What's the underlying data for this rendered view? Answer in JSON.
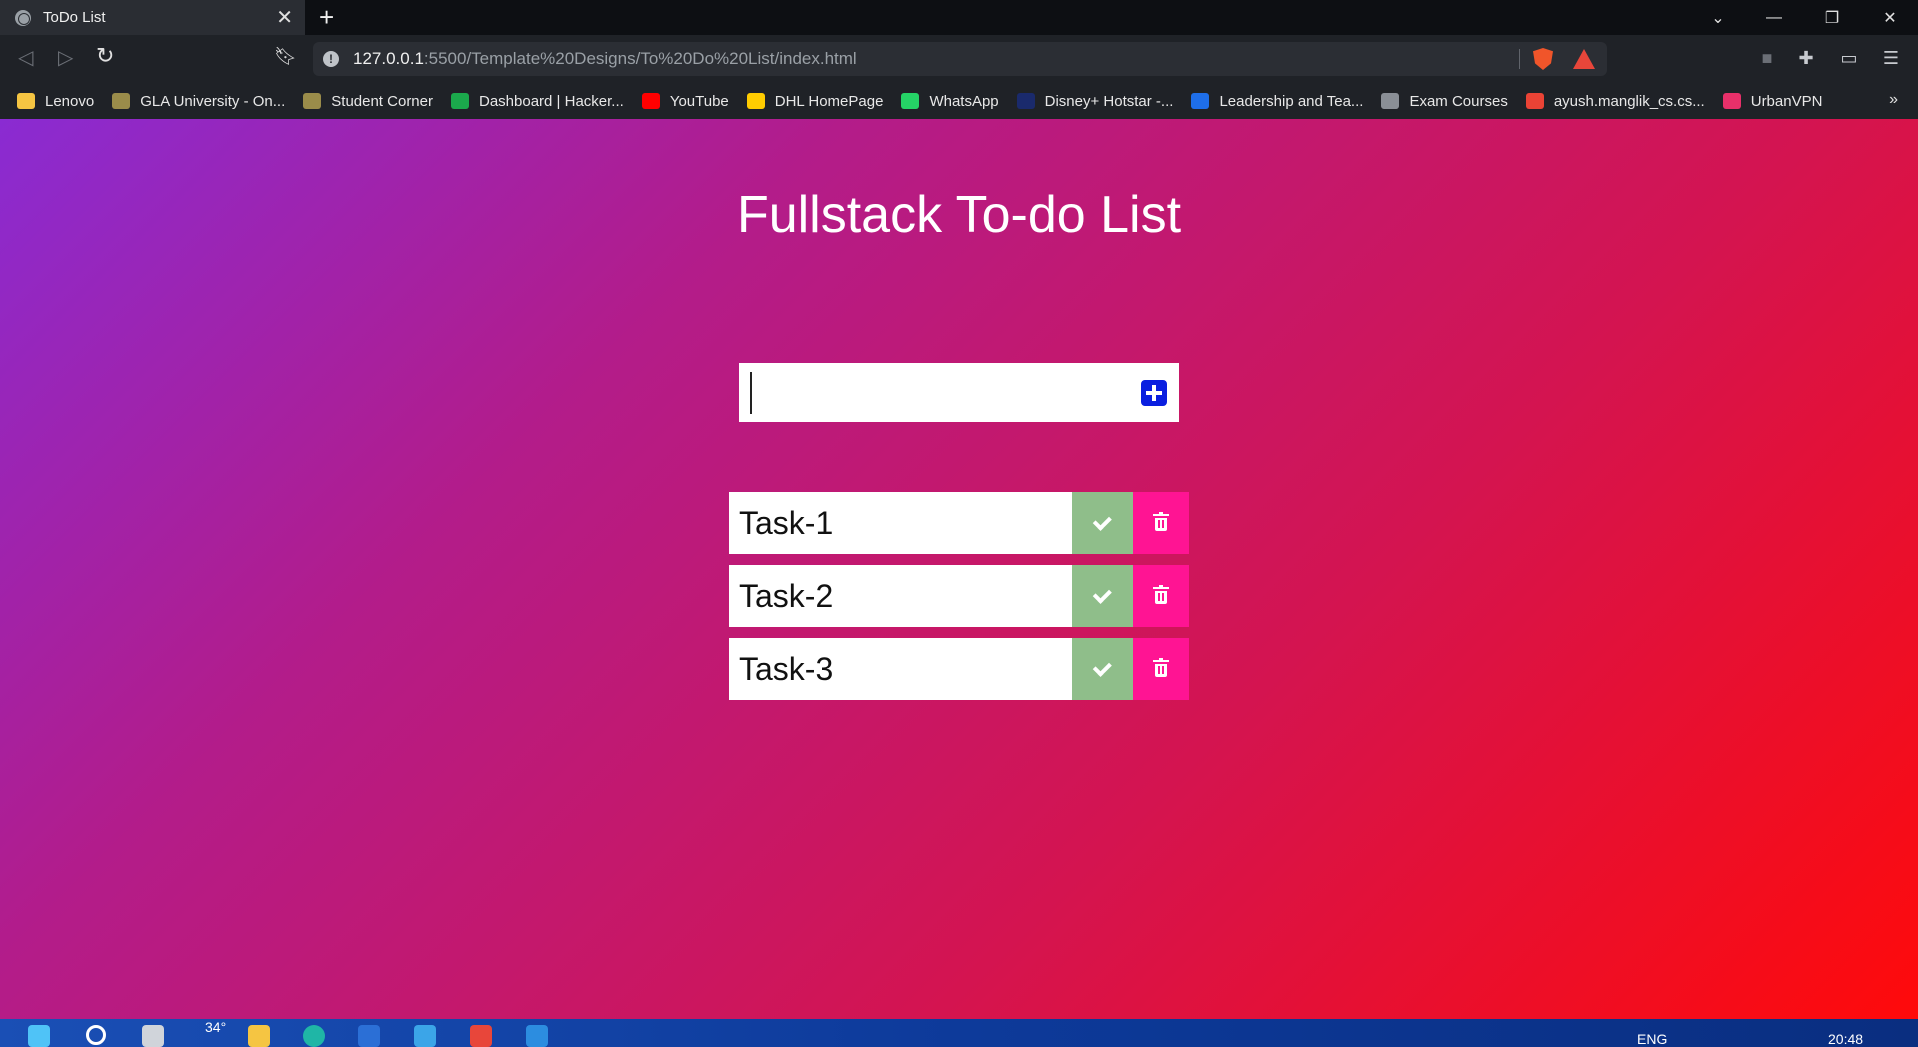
{
  "browser": {
    "tab": {
      "title": "ToDo List",
      "close": "✕"
    },
    "new_tab": "+",
    "window_controls": {
      "menu": "⌄",
      "minimize": "—",
      "restore": "❐",
      "close": "✕"
    },
    "url": {
      "host": "127.0.0.1",
      "path": ":5500/Template%20Designs/To%20Do%20List/index.html"
    },
    "bookmarks": [
      {
        "label": "Lenovo",
        "icon": "folder-icon",
        "color": "#f5c542"
      },
      {
        "label": "GLA University - On...",
        "icon": "gla-icon",
        "color": "#9a8c4a"
      },
      {
        "label": "Student Corner",
        "icon": "gla-icon",
        "color": "#9a8c4a"
      },
      {
        "label": "Dashboard | Hacker...",
        "icon": "hackerrank-icon",
        "color": "#1ba94c"
      },
      {
        "label": "YouTube",
        "icon": "youtube-icon",
        "color": "#ff0000"
      },
      {
        "label": "DHL HomePage",
        "icon": "dhl-icon",
        "color": "#ffcc00"
      },
      {
        "label": "WhatsApp",
        "icon": "whatsapp-icon",
        "color": "#25d366"
      },
      {
        "label": "Disney+ Hotstar -...",
        "icon": "hotstar-icon",
        "color": "#1a2a6c"
      },
      {
        "label": "Leadership and Tea...",
        "icon": "s-icon",
        "color": "#1e6ee8"
      },
      {
        "label": "Exam Courses",
        "icon": "globe-icon",
        "color": "#8a8f96"
      },
      {
        "label": "ayush.manglik_cs.cs...",
        "icon": "gmail-icon",
        "color": "#ea4335"
      },
      {
        "label": "UrbanVPN",
        "icon": "urbanvpn-icon",
        "color": "#e8306a"
      }
    ],
    "bookmarks_more": "»"
  },
  "app": {
    "title": "Fullstack To-do List",
    "input": {
      "value": "",
      "placeholder": ""
    },
    "tasks": [
      {
        "text": "Task-1"
      },
      {
        "text": "Task-2"
      },
      {
        "text": "Task-3"
      }
    ],
    "colors": {
      "complete": "#8fbe8a",
      "delete": "#ff1493",
      "add": "#0a1fe0"
    }
  },
  "taskbar": {
    "weather": "34°",
    "language": "ENG",
    "time": "20:48"
  }
}
